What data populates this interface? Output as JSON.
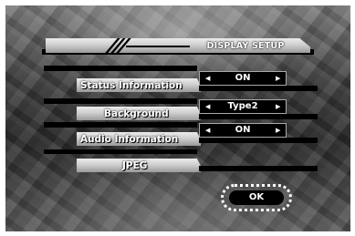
{
  "header": {
    "title": "DISPLAY SETUP"
  },
  "settings": [
    {
      "label": "Status Information",
      "value": "ON"
    },
    {
      "label": "Background",
      "value": "Type2"
    },
    {
      "label": "Audio Information",
      "value": "ON"
    }
  ],
  "jpeg": {
    "label": "JPEG"
  },
  "ok_button": {
    "label": "OK"
  },
  "icons": {
    "left_arrow": "arrow-left-icon",
    "right_arrow": "arrow-right-icon"
  }
}
